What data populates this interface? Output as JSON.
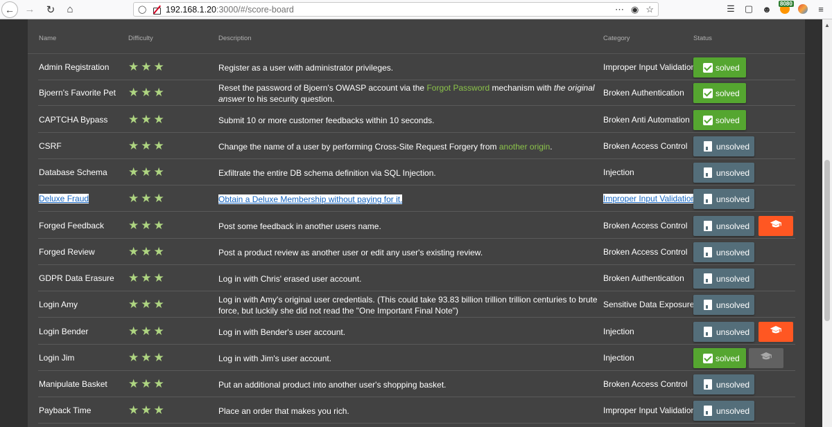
{
  "browser": {
    "url_host": "192.168.1.20",
    "url_rest": ":3000/#/score-board",
    "proxy_badge": "8080"
  },
  "table": {
    "headers": {
      "name": "Name",
      "difficulty": "Difficulty",
      "description": "Description",
      "category": "Category",
      "status": "Status"
    },
    "rows": [
      {
        "name": "Admin Registration",
        "stars": "★★★",
        "desc": [
          {
            "t": "Register as a user with administrator privileges."
          }
        ],
        "category": "Improper Input Validation",
        "status": "solved",
        "hint": "none"
      },
      {
        "name": "Bjoern's Favorite Pet",
        "stars": "★★★",
        "desc": [
          {
            "t": "Reset the password of Bjoern's OWASP account via the "
          },
          {
            "t": "Forgot Password",
            "k": "link"
          },
          {
            "t": " mechanism with "
          },
          {
            "t": "the original answer",
            "k": "em"
          },
          {
            "t": " to his security question."
          }
        ],
        "category": "Broken Authentication",
        "status": "solved",
        "hint": "none"
      },
      {
        "name": "CAPTCHA Bypass",
        "stars": "★★★",
        "desc": [
          {
            "t": "Submit 10 or more customer feedbacks within 10 seconds."
          }
        ],
        "category": "Broken Anti Automation",
        "status": "solved",
        "hint": "none"
      },
      {
        "name": "CSRF",
        "stars": "★★★",
        "desc": [
          {
            "t": "Change the name of a user by performing Cross-Site Request Forgery from "
          },
          {
            "t": "another origin",
            "k": "link"
          },
          {
            "t": "."
          }
        ],
        "category": "Broken Access Control",
        "status": "unsolved",
        "hint": "none"
      },
      {
        "name": "Database Schema",
        "stars": "★★★",
        "desc": [
          {
            "t": "Exfiltrate the entire DB schema definition via SQL Injection."
          }
        ],
        "category": "Injection",
        "status": "unsolved",
        "hint": "none"
      },
      {
        "name": "Deluxe Fraud",
        "stars": "★★★",
        "desc": [
          {
            "t": "Obtain a Deluxe Membership without paying for it."
          }
        ],
        "category": "Improper Input Validation",
        "status": "unsolved",
        "hint": "none",
        "selected": true
      },
      {
        "name": "Forged Feedback",
        "stars": "★★★",
        "desc": [
          {
            "t": "Post some feedback in another users name."
          }
        ],
        "category": "Broken Access Control",
        "status": "unsolved",
        "hint": "orange"
      },
      {
        "name": "Forged Review",
        "stars": "★★★",
        "desc": [
          {
            "t": "Post a product review as another user or edit any user's existing review."
          }
        ],
        "category": "Broken Access Control",
        "status": "unsolved",
        "hint": "none"
      },
      {
        "name": "GDPR Data Erasure",
        "stars": "★★★",
        "desc": [
          {
            "t": "Log in with Chris' erased user account."
          }
        ],
        "category": "Broken Authentication",
        "status": "unsolved",
        "hint": "none"
      },
      {
        "name": "Login Amy",
        "stars": "★★★",
        "desc": [
          {
            "t": "Log in with Amy's original user credentials. (This could take 93.83 billion trillion trillion centuries to brute force, but luckily she did not read the \"One Important Final Note\")"
          }
        ],
        "category": "Sensitive Data Exposure",
        "status": "unsolved",
        "hint": "none"
      },
      {
        "name": "Login Bender",
        "stars": "★★★",
        "desc": [
          {
            "t": "Log in with Bender's user account."
          }
        ],
        "category": "Injection",
        "status": "unsolved",
        "hint": "orange"
      },
      {
        "name": "Login Jim",
        "stars": "★★★",
        "desc": [
          {
            "t": "Log in with Jim's user account."
          }
        ],
        "category": "Injection",
        "status": "solved",
        "hint": "grey"
      },
      {
        "name": "Manipulate Basket",
        "stars": "★★★",
        "desc": [
          {
            "t": "Put an additional product into another user's shopping basket."
          }
        ],
        "category": "Broken Access Control",
        "status": "unsolved",
        "hint": "none"
      },
      {
        "name": "Payback Time",
        "stars": "★★★",
        "desc": [
          {
            "t": "Place an order that makes you rich."
          }
        ],
        "category": "Improper Input Validation",
        "status": "unsolved",
        "hint": "none"
      }
    ]
  }
}
